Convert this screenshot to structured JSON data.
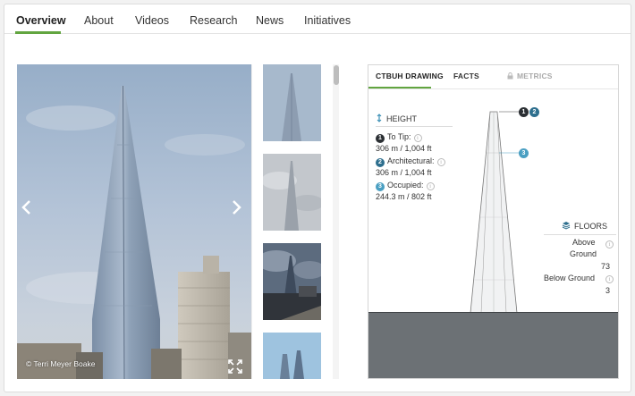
{
  "nav": {
    "tabs": [
      {
        "label": "Overview"
      },
      {
        "label": "About"
      },
      {
        "label": "Videos"
      },
      {
        "label": "Research"
      },
      {
        "label": "News"
      },
      {
        "label": "Initiatives"
      }
    ],
    "active_index": 0,
    "accent": "#62a540"
  },
  "gallery": {
    "credit": "© Terri Meyer Boake",
    "prev_icon": "chevron-left-icon",
    "next_icon": "chevron-right-icon",
    "expand_icon": "expand-icon"
  },
  "drawing_panel": {
    "tabs": {
      "drawing": "CTBUH DRAWING",
      "facts": "FACTS",
      "metrics": "METRICS"
    },
    "height": {
      "header": "HEIGHT",
      "to_tip_label": "To Tip:",
      "to_tip_value": "306 m / 1,004 ft",
      "architectural_label": "Architectural:",
      "architectural_value": "306 m / 1,004 ft",
      "occupied_label": "Occupied:",
      "occupied_value": "244.3 m / 802 ft",
      "badge_1": "1",
      "badge_2": "2",
      "badge_3": "3"
    },
    "floors": {
      "header": "FLOORS",
      "above_label_1": "Above",
      "above_label_2": "Ground",
      "above_value": "73",
      "below_label": "Below Ground",
      "below_value": "3"
    },
    "colors": {
      "badge_tip": "#2b2f33",
      "badge_arch": "#2e6f8e",
      "badge_occ": "#4a9fc2",
      "ground": "#6c7175"
    }
  }
}
